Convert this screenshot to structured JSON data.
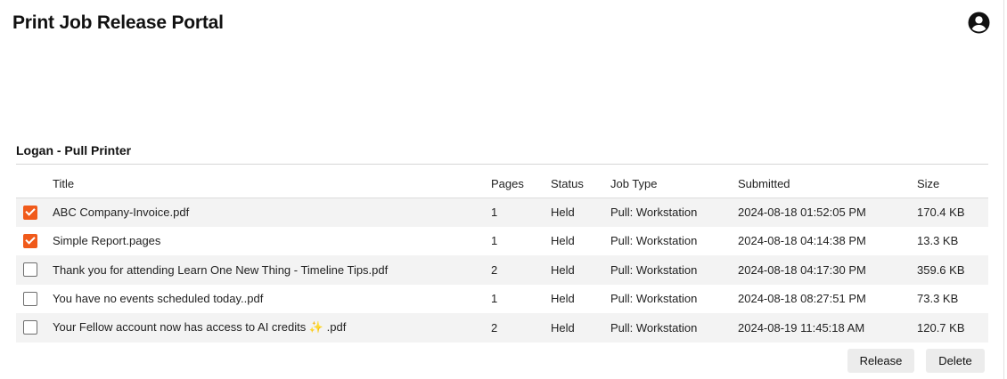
{
  "header": {
    "title": "Print Job Release Portal",
    "account_icon": "account-circle-icon"
  },
  "queue": {
    "title": "Logan - Pull Printer"
  },
  "table": {
    "columns": {
      "title": "Title",
      "pages": "Pages",
      "status": "Status",
      "job_type": "Job Type",
      "submitted": "Submitted",
      "size": "Size"
    },
    "rows": [
      {
        "checked": true,
        "title": "ABC Company-Invoice.pdf",
        "pages": "1",
        "status": "Held",
        "job_type": "Pull: Workstation",
        "submitted": "2024-08-18 01:52:05 PM",
        "size": "170.4 KB"
      },
      {
        "checked": true,
        "title": "Simple Report.pages",
        "pages": "1",
        "status": "Held",
        "job_type": "Pull: Workstation",
        "submitted": "2024-08-18 04:14:38 PM",
        "size": "13.3 KB"
      },
      {
        "checked": false,
        "title": "Thank you for attending Learn One New Thing - Timeline Tips.pdf",
        "pages": "2",
        "status": "Held",
        "job_type": "Pull: Workstation",
        "submitted": "2024-08-18 04:17:30 PM",
        "size": "359.6 KB"
      },
      {
        "checked": false,
        "title": "You have no events scheduled today..pdf",
        "pages": "1",
        "status": "Held",
        "job_type": "Pull: Workstation",
        "submitted": "2024-08-18 08:27:51 PM",
        "size": "73.3 KB"
      },
      {
        "checked": false,
        "title": "Your Fellow account now has access to AI credits ✨ .pdf",
        "pages": "2",
        "status": "Held",
        "job_type": "Pull: Workstation",
        "submitted": "2024-08-19 11:45:18 AM",
        "size": "120.7 KB"
      }
    ]
  },
  "actions": {
    "release_label": "Release",
    "delete_label": "Delete"
  },
  "colors": {
    "accent": "#f05a1a",
    "row_stripe": "#f3f3f3",
    "button_bg": "#ececec"
  }
}
